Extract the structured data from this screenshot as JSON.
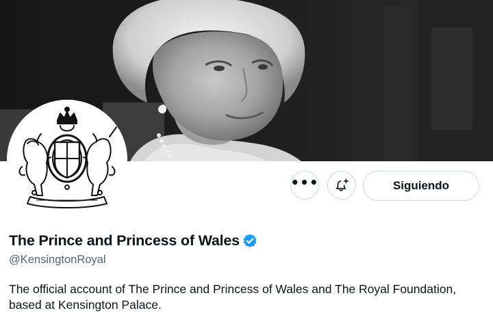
{
  "profile": {
    "display_name": "The Prince and Princess of Wales",
    "handle": "@KensingtonRoyal",
    "bio": "The official account of The Prince and Princess of Wales and The Royal Foundation, based at Kensington Palace.",
    "verified": true
  },
  "actions": {
    "more_label": "•••",
    "follow_label": "Siguiendo"
  },
  "icons": {
    "more": "more-horizontal-icon",
    "notify": "bell-plus-icon",
    "verified": "verified-badge-icon"
  },
  "colors": {
    "verified_blue": "#1d9bf0",
    "text_primary": "#0f1419",
    "text_secondary": "#536471",
    "border": "#cfd9de"
  }
}
